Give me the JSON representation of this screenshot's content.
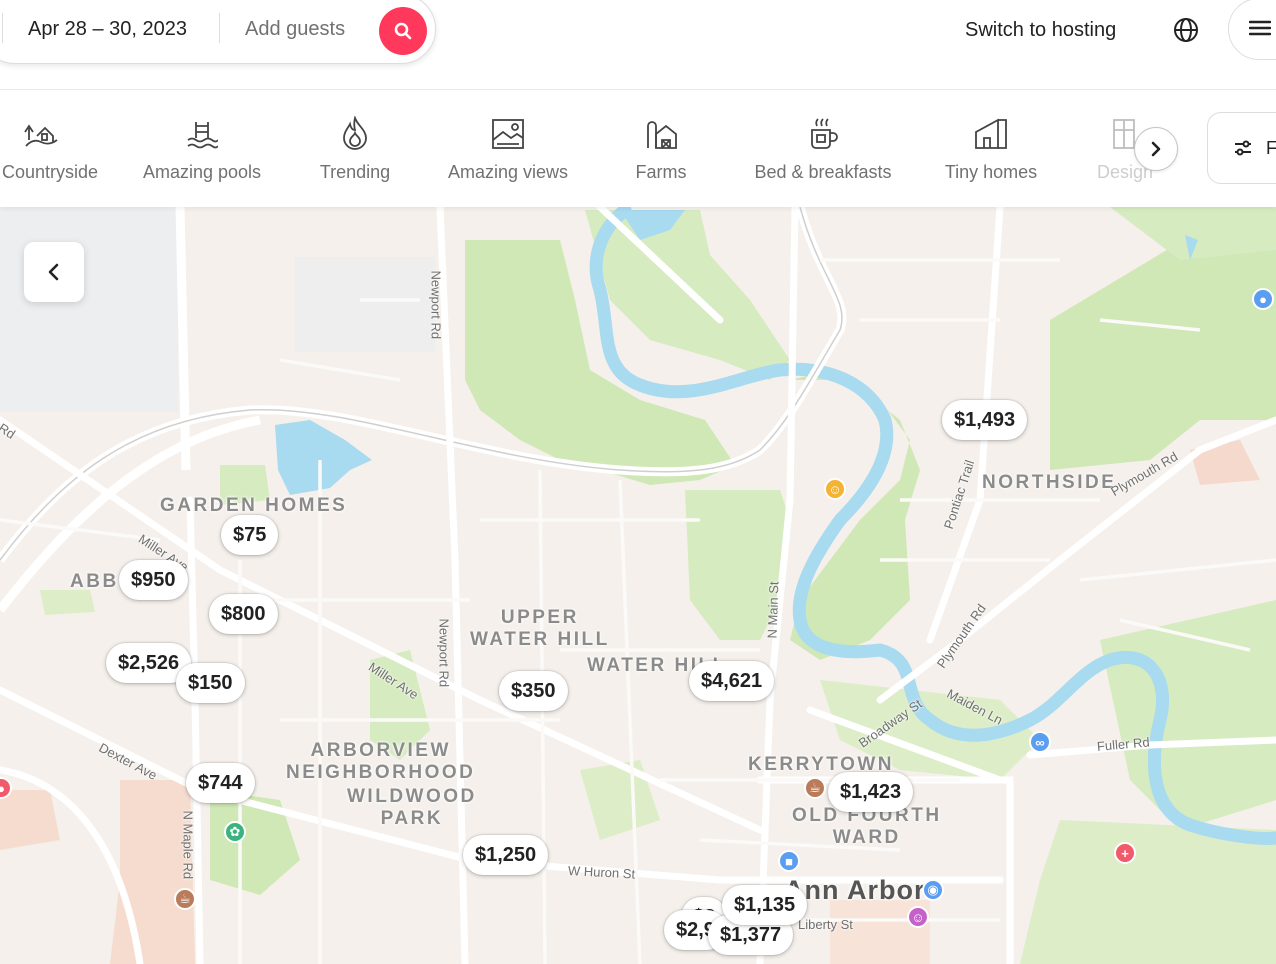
{
  "header": {
    "dates": "Apr 28 – 30, 2023",
    "guests_placeholder": "Add guests",
    "switch_hosting": "Switch to hosting",
    "brand_color": "#ff385c"
  },
  "categories": [
    {
      "label": "Countryside",
      "icon": "countryside-icon"
    },
    {
      "label": "Amazing pools",
      "icon": "pool-icon"
    },
    {
      "label": "Trending",
      "icon": "flame-icon"
    },
    {
      "label": "Amazing views",
      "icon": "views-icon"
    },
    {
      "label": "Farms",
      "icon": "farm-icon"
    },
    {
      "label": "Bed & breakfasts",
      "icon": "coffee-cup-icon"
    },
    {
      "label": "Tiny homes",
      "icon": "tiny-home-icon"
    },
    {
      "label": "Design",
      "icon": "design-icon"
    }
  ],
  "filters_label": "Filters",
  "map": {
    "neighborhoods": {
      "garden_homes": "GARDEN HOMES",
      "abbot": "ABBOT",
      "upper_water_hill": "UPPER\nWATER HILL",
      "water_hill": "WATER HILL",
      "northside": "NORTHSIDE",
      "arborview": "ARBORVIEW\nNEIGHBORHOOD",
      "wildwood": "WILDWOOD\nPARK",
      "kerrytown": "KERRYTOWN",
      "old_fourth_ward": "OLD FOURTH\nWARD"
    },
    "city": "Ann Arbor",
    "streets": {
      "newport_1": "Newport Rd",
      "newport_2": "Newport Rd",
      "miller_1": "Miller Ave",
      "miller_2": "Miller Ave",
      "dexter": "Dexter Ave",
      "maple": "N Maple Rd",
      "main": "N Main St",
      "pontiac": "Pontiac Trail",
      "plymouth_1": "Plymouth Rd",
      "plymouth_2": "Plymouth Rd",
      "broadway": "Broadway St",
      "maiden": "Maiden Ln",
      "fuller": "Fuller Rd",
      "huron": "W Huron St",
      "liberty": "Liberty St",
      "rd_left": "Rd"
    },
    "price_pins": [
      "$1,493",
      "$75",
      "$950",
      "$800",
      "$2,526",
      "$150",
      "$350",
      "$4,621",
      "$744",
      "$1,423",
      "$1,250",
      "$1,135",
      "$1,377",
      "$2,9",
      "$2"
    ]
  }
}
